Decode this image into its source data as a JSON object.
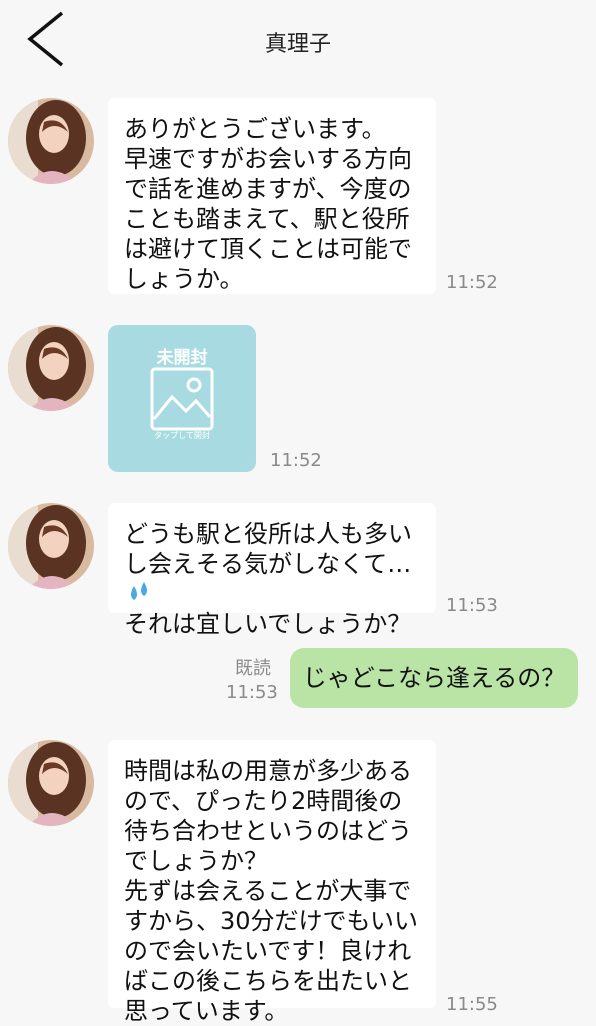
{
  "header": {
    "title": "真理子"
  },
  "messages": {
    "m1": {
      "lines": [
        "ありがとうございます。",
        "早速ですがお会いする方向",
        "で話を進めますが、今度の",
        "ことも踏まえて、駅と役所",
        "は避けて頂くことは可能で",
        "しょうか。"
      ],
      "time": "11:52"
    },
    "m2": {
      "unopened_label": "未開封",
      "tap_label": "タップして開封",
      "time": "11:52"
    },
    "m3": {
      "lines": [
        "どうも駅と役所は人も多い",
        "し会えそる気がしなくて…",
        "それは宜しいでしょうか？"
      ],
      "time": "11:53"
    },
    "m4": {
      "text": "じゃどこなら逢えるの？",
      "read_label": "既読",
      "time": "11:53"
    },
    "m5": {
      "lines": [
        "時間は私の用意が多少ある",
        "ので、ぴったり2時間後の",
        "待ち合わせというのはどう",
        "でしょうか？",
        "先ずは会えることが大事で",
        "すから、30分だけでもいい",
        "ので会いたいです！良けれ",
        "ばこの後こちらを出たいと",
        "思っています。"
      ],
      "time": "11:55"
    }
  },
  "colors": {
    "mine_bubble": "#b9e4a5",
    "unopened": "#a8dbe1"
  }
}
